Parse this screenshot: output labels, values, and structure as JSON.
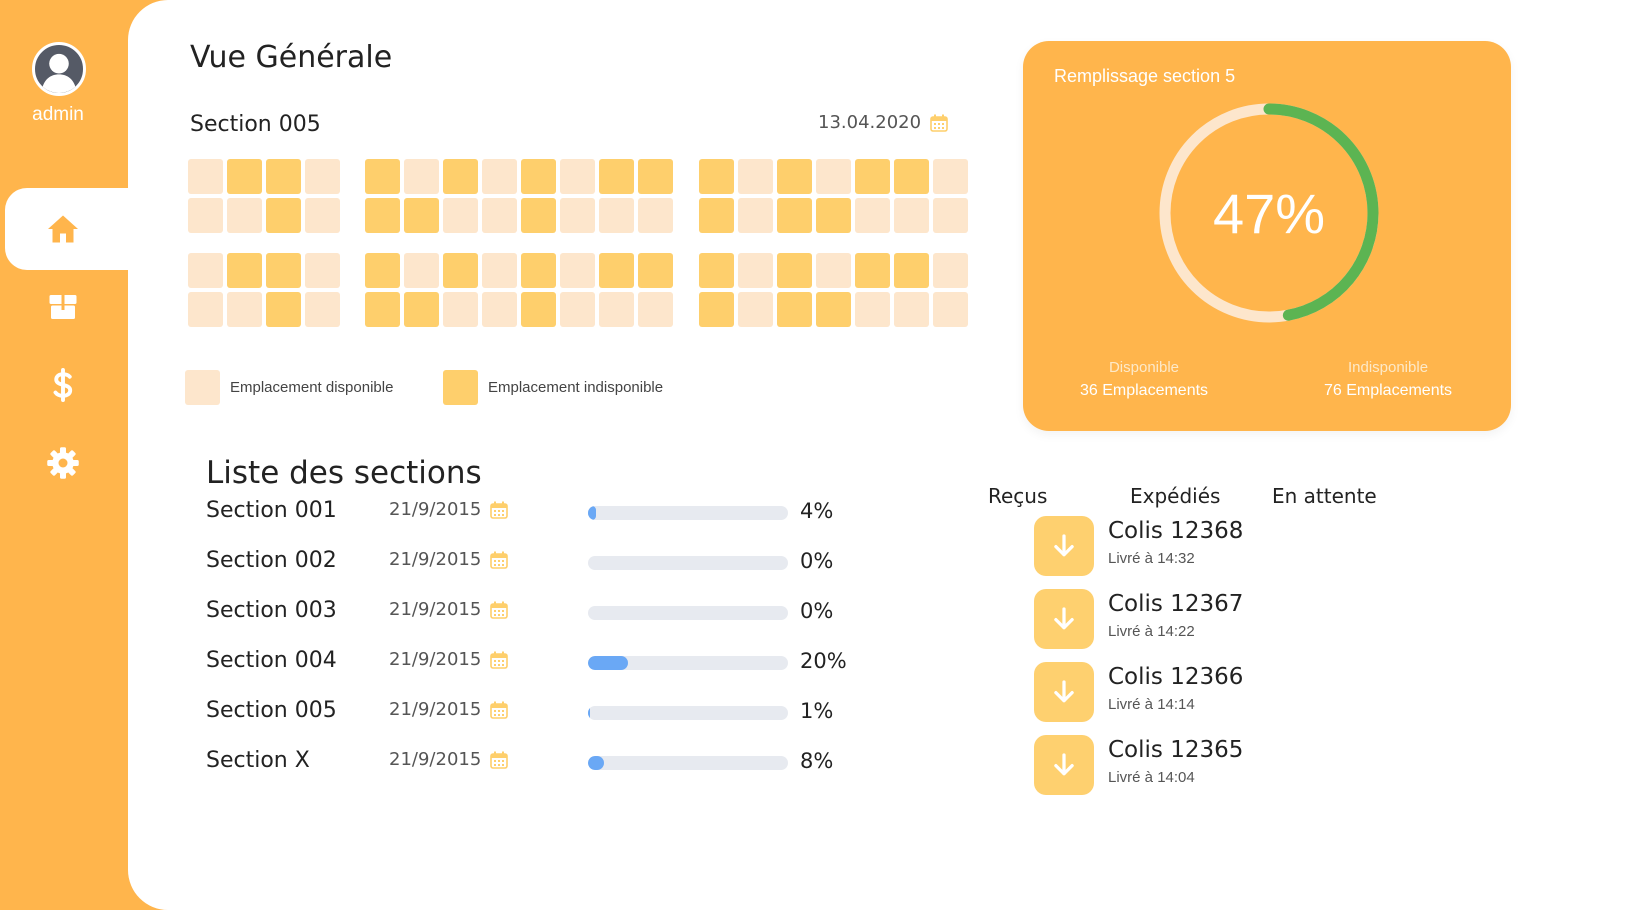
{
  "user": {
    "name": "admin"
  },
  "nav": [
    {
      "icon": "home-icon",
      "active": true
    },
    {
      "icon": "box-icon",
      "active": false
    },
    {
      "icon": "dollar-icon",
      "active": false
    },
    {
      "icon": "gear-icon",
      "active": false
    }
  ],
  "overview": {
    "title": "Vue Générale",
    "section_name": "Section 005",
    "date": "13.04.2020",
    "grid": [
      [
        0,
        1,
        1,
        0,
        1,
        0,
        1,
        0,
        1,
        0,
        1,
        1,
        1,
        0,
        1,
        0,
        1,
        1,
        0
      ],
      [
        0,
        0,
        1,
        0,
        1,
        1,
        0,
        0,
        1,
        0,
        0,
        0,
        1,
        0,
        1,
        1,
        0,
        0,
        0
      ],
      [
        0,
        1,
        1,
        0,
        1,
        0,
        1,
        0,
        1,
        0,
        1,
        1,
        1,
        0,
        1,
        0,
        1,
        1,
        0
      ],
      [
        0,
        0,
        1,
        0,
        1,
        1,
        0,
        0,
        1,
        0,
        0,
        0,
        1,
        0,
        1,
        1,
        0,
        0,
        0
      ]
    ],
    "legend": {
      "available": "Emplacement disponible",
      "unavailable": "Emplacement indisponible"
    },
    "colors": {
      "available": "#FDE6CC",
      "unavailable": "#FECF6C",
      "accent": "#FFB54C"
    }
  },
  "sections": {
    "title": "Liste des sections",
    "rows": [
      {
        "name": "Section 001",
        "date": "21/9/2015",
        "percent": 4,
        "percent_label": "4%"
      },
      {
        "name": "Section 002",
        "date": "21/9/2015",
        "percent": 0,
        "percent_label": "0%"
      },
      {
        "name": "Section 003",
        "date": "21/9/2015",
        "percent": 0,
        "percent_label": "0%"
      },
      {
        "name": "Section 004",
        "date": "21/9/2015",
        "percent": 20,
        "percent_label": "20%"
      },
      {
        "name": "Section 005",
        "date": "21/9/2015",
        "percent": 1,
        "percent_label": "1%"
      },
      {
        "name": "Section X",
        "date": "21/9/2015",
        "percent": 8,
        "percent_label": "8%"
      }
    ]
  },
  "fill": {
    "title": "Remplissage section 5",
    "percent": 47,
    "percent_label": "47%",
    "available_label": "Disponible",
    "available_value": "36 Emplacements",
    "unavailable_label": "Indisponible",
    "unavailable_value": "76 Emplacements",
    "colors": {
      "progress": "#5CB452",
      "track": "#FDE6CC"
    }
  },
  "tabs": [
    "Reçus",
    "Expédiés",
    "En attente"
  ],
  "parcels": [
    {
      "title": "Colis 12368",
      "subtitle": "Livré à 14:32"
    },
    {
      "title": "Colis 12367",
      "subtitle": "Livré à 14:22"
    },
    {
      "title": "Colis 12366",
      "subtitle": "Livré à 14:14"
    },
    {
      "title": "Colis 12365",
      "subtitle": "Livré à 14:04"
    }
  ]
}
